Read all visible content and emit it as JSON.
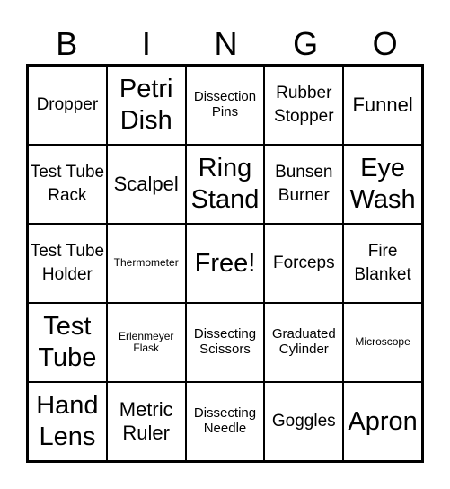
{
  "header": [
    "B",
    "I",
    "N",
    "G",
    "O"
  ],
  "cells": [
    "Dropper",
    "Petri Dish",
    "Dissection Pins",
    "Rubber Stopper",
    "Funnel",
    "Test Tube Rack",
    "Scalpel",
    "Ring Stand",
    "Bunsen Burner",
    "Eye Wash",
    "Test Tube Holder",
    "Thermometer",
    "Free!",
    "Forceps",
    "Fire Blanket",
    "Test Tube",
    "Erlenmeyer Flask",
    "Dissecting Scissors",
    "Graduated Cylinder",
    "Microscope",
    "Hand Lens",
    "Metric Ruler",
    "Dissecting Needle",
    "Goggles",
    "Apron"
  ]
}
